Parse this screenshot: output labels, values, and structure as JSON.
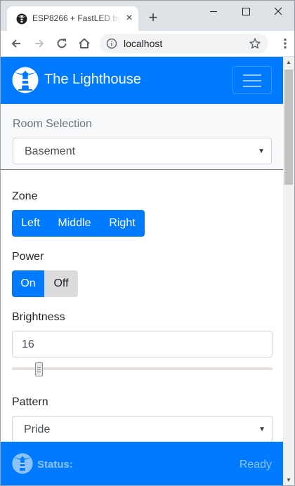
{
  "browser": {
    "tab_title": "ESP8266 + FastLED by",
    "tab_close_glyph": "×",
    "new_tab_glyph": "+",
    "url": "localhost"
  },
  "navbar": {
    "brand": "The Lighthouse"
  },
  "room": {
    "label": "Room Selection",
    "selected": "Basement"
  },
  "zone": {
    "label": "Zone",
    "options": [
      "Left",
      "Middle",
      "Right"
    ]
  },
  "power": {
    "label": "Power",
    "on_label": "On",
    "off_label": "Off"
  },
  "brightness": {
    "label": "Brightness",
    "value": "16"
  },
  "pattern": {
    "label": "Pattern",
    "selected": "Pride"
  },
  "footer": {
    "status_label": "Status:",
    "status_value": "Ready"
  },
  "colors": {
    "primary": "#007bff",
    "tab_strip": "#dee1e6",
    "off_button": "#dcdcdc"
  },
  "icons": [
    "lighthouse-icon",
    "back-arrow-icon",
    "forward-arrow-icon",
    "reload-icon",
    "home-icon",
    "info-icon",
    "star-icon",
    "menu-dots-icon",
    "hamburger-icon",
    "minimize-icon",
    "maximize-icon",
    "close-icon"
  ]
}
